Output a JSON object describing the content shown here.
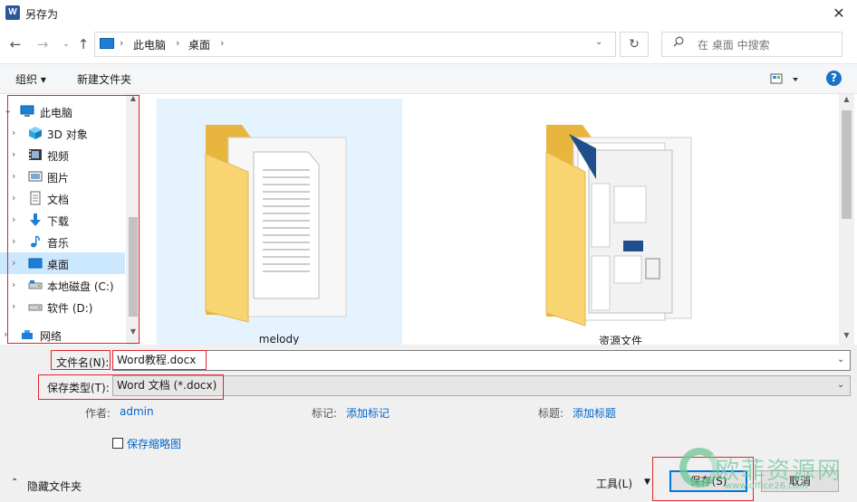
{
  "window": {
    "title": "另存为",
    "app_icon_letter": "W"
  },
  "nav": {
    "back": "←",
    "forward": "→",
    "recent": "⌄",
    "up": "↑",
    "breadcrumbs": [
      "此电脑",
      "桌面"
    ],
    "separator": "›",
    "refresh": "↻",
    "dropdown": "⌄",
    "search_placeholder": "在 桌面 中搜索"
  },
  "toolbar": {
    "organize": "组织 ▾",
    "new_folder": "新建文件夹",
    "help": "?"
  },
  "tree": [
    {
      "label": "此电脑",
      "icon": "computer-icon"
    },
    {
      "label": "3D 对象",
      "icon": "cube-icon"
    },
    {
      "label": "视频",
      "icon": "video-icon"
    },
    {
      "label": "图片",
      "icon": "picture-icon"
    },
    {
      "label": "文档",
      "icon": "document-icon"
    },
    {
      "label": "下载",
      "icon": "download-icon"
    },
    {
      "label": "音乐",
      "icon": "music-icon"
    },
    {
      "label": "桌面",
      "icon": "desktop-icon",
      "selected": true
    },
    {
      "label": "本地磁盘 (C:)",
      "icon": "drive-icon"
    },
    {
      "label": "软件 (D:)",
      "icon": "drive-icon"
    },
    {
      "label": "网络",
      "icon": "network-icon"
    }
  ],
  "content": {
    "items": [
      {
        "label": "melody"
      },
      {
        "label": "资源文件"
      }
    ]
  },
  "form": {
    "filename_label": "文件名(N):",
    "filename_value": "Word教程.docx",
    "filetype_label": "保存类型(T):",
    "filetype_value": "Word 文档 (*.docx)",
    "author_key": "作者:",
    "author_val": "admin",
    "tags_key": "标记:",
    "tags_val": "添加标记",
    "title_key": "标题:",
    "title_val": "添加标题",
    "thumbnail_label": "保存缩略图",
    "hide_folders": "隐藏文件夹",
    "tools": "工具(L)",
    "save": "保存(S)",
    "cancel": "取消"
  },
  "watermark": {
    "text": "欧菲资源网",
    "url": "www.office26.com"
  },
  "colors": {
    "highlight": "#e0242c",
    "accent": "#0078d7",
    "selection": "#cce8ff",
    "folder": "#f5d06b"
  }
}
